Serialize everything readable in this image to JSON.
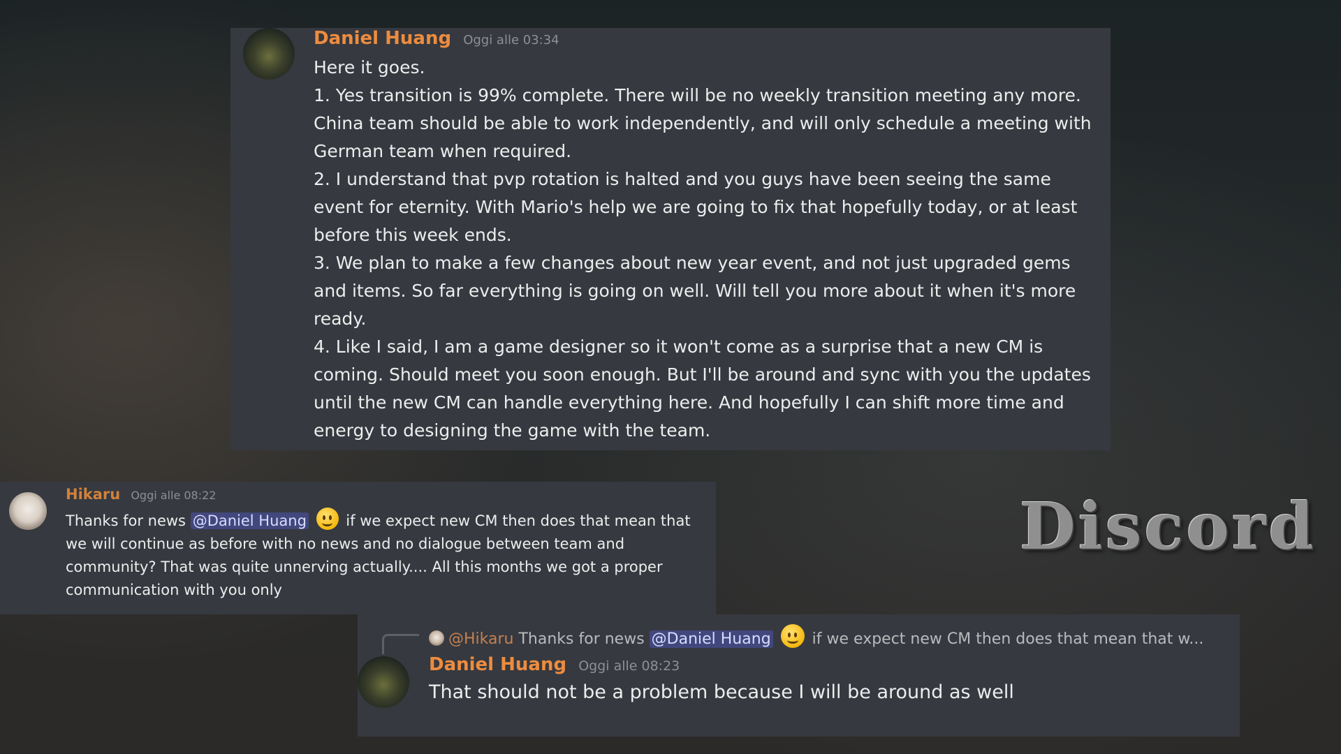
{
  "message1": {
    "author": "Daniel Huang",
    "timestamp": "Oggi alle 03:34",
    "lines": [
      "Here it goes.",
      "1. Yes transition is 99% complete. There will be no weekly transition meeting any more. China team should be able to work independently, and will only schedule a meeting with German team when required.",
      "2. I understand that pvp rotation is halted and you guys have been seeing the same event for eternity. With Mario's help we are going to fix that hopefully today, or at least before this week ends.",
      "3. We plan to make a few changes about new year event, and not just upgraded gems and items. So far everything is going on well. Will tell you more about it when it's more ready.",
      "4. Like I said, I am a game designer so it won't come as a surprise that a new CM is coming. Should meet you soon enough. But I'll be around and sync with you the updates until the new CM can handle everything here. And hopefully I can shift more time and energy to designing the game with the team."
    ]
  },
  "message2": {
    "author": "Hikaru",
    "timestamp": "Oggi alle 08:22",
    "text_before": "Thanks for news",
    "mention": "@Daniel Huang",
    "emoji": "slightly-smiling-face",
    "text_after": "if we expect new CM then does that mean that we will continue as before with no news and no dialogue between team and community? That was quite unnerving actually.... All this months we got a proper communication with you only"
  },
  "message3": {
    "reply": {
      "author": "@Hikaru",
      "text_before": "Thanks for news",
      "mention": "@Daniel Huang",
      "text_after": "if we expect new CM then does that mean that w..."
    },
    "author": "Daniel Huang",
    "timestamp": "Oggi alle 08:23",
    "text": "That should not be a problem because I will be around as well"
  },
  "logo": {
    "text": "Discord"
  },
  "colors": {
    "card_bg": "#36393f",
    "author_orange": "#ed8c3f",
    "mention_bg": "#5865f2",
    "timestamp": "#8c8f93"
  }
}
